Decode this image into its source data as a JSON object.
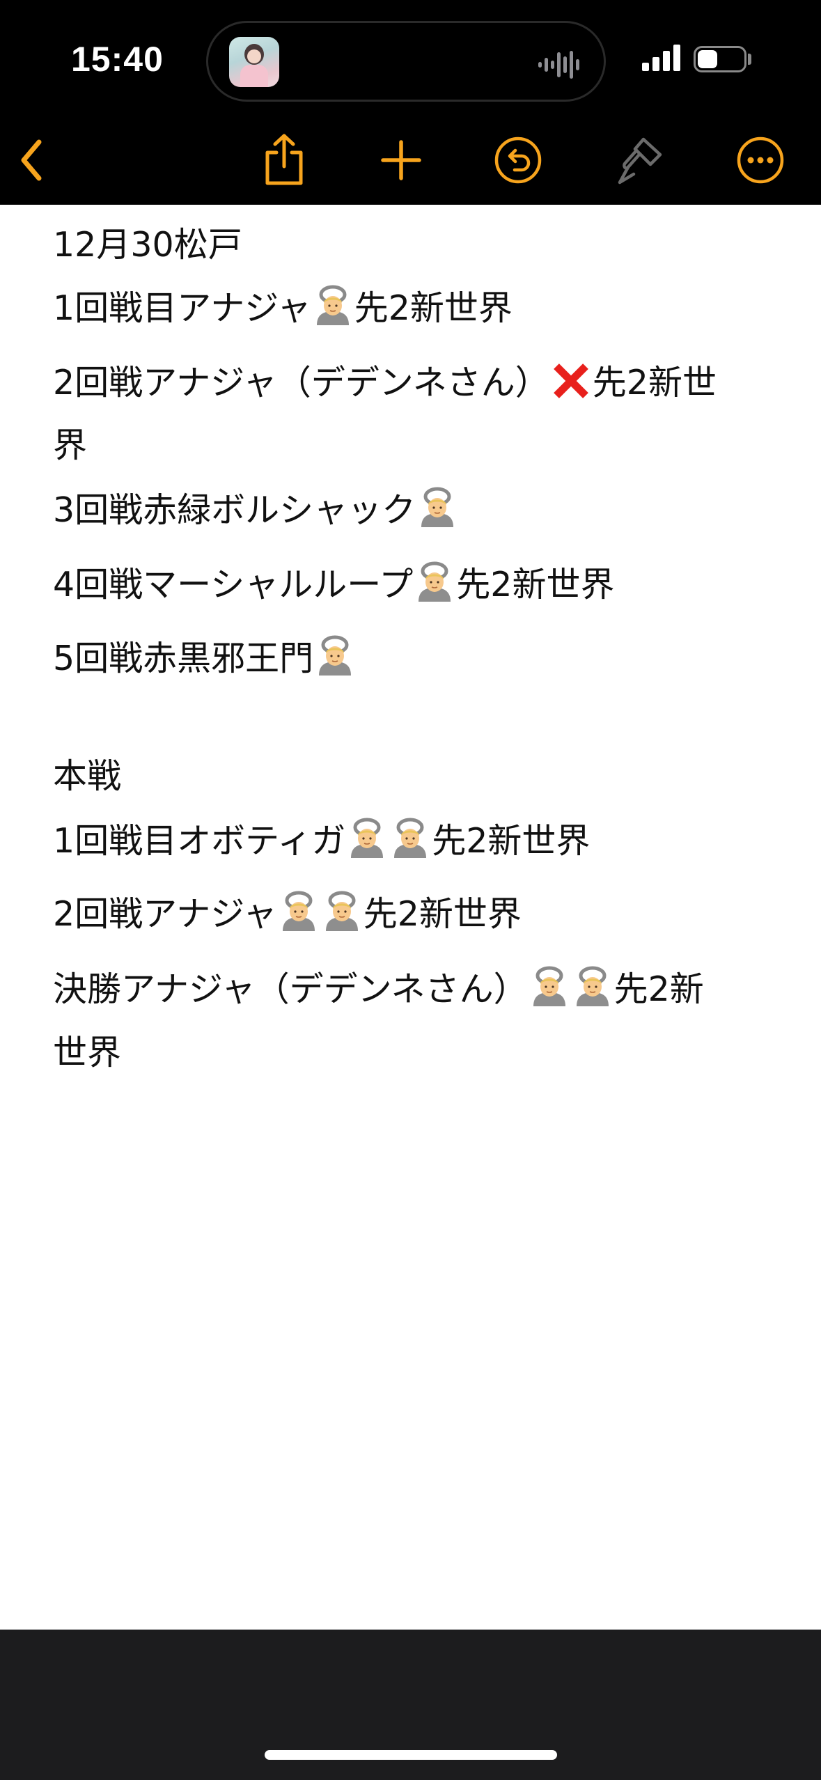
{
  "status_bar": {
    "time": "15:40",
    "icons": [
      "cellular-signal-icon",
      "battery-icon",
      "waveform-icon"
    ]
  },
  "toolbar": {
    "accent_color": "#f7a41d",
    "disabled_color": "#6b6b6b",
    "buttons": [
      "back",
      "share",
      "add",
      "undo",
      "format-brush",
      "more"
    ]
  },
  "note": {
    "lines": [
      {
        "segments": [
          {
            "text": "12月30松戸"
          }
        ]
      },
      {
        "segments": [
          {
            "text": "1回戦目アナジャ"
          },
          {
            "emoji": "ok-gesture-person"
          },
          {
            "text": "先2新世界"
          }
        ]
      },
      {
        "segments": [
          {
            "text": "2回戦アナジャ（デデンネさん）"
          },
          {
            "emoji": "red-cross-mark"
          },
          {
            "text": "先2新世"
          }
        ]
      },
      {
        "segments": [
          {
            "text": "界"
          }
        ]
      },
      {
        "segments": [
          {
            "text": "3回戦赤緑ボルシャック"
          },
          {
            "emoji": "ok-gesture-person"
          }
        ]
      },
      {
        "segments": [
          {
            "text": "4回戦マーシャルループ"
          },
          {
            "emoji": "ok-gesture-person"
          },
          {
            "text": "先2新世界"
          }
        ]
      },
      {
        "segments": [
          {
            "text": "5回戦赤黒邪王門"
          },
          {
            "emoji": "ok-gesture-person"
          }
        ]
      },
      {
        "segments": [
          {
            "text": "本戦"
          }
        ]
      },
      {
        "segments": [
          {
            "text": "1回戦目オボティガ"
          },
          {
            "emoji": "ok-gesture-person"
          },
          {
            "emoji": "ok-gesture-person"
          },
          {
            "text": "先2新世界"
          }
        ]
      },
      {
        "segments": [
          {
            "text": "2回戦アナジャ"
          },
          {
            "emoji": "ok-gesture-person"
          },
          {
            "emoji": "ok-gesture-person"
          },
          {
            "text": "先2新世界"
          }
        ]
      },
      {
        "segments": [
          {
            "text": "決勝アナジャ（デデンネさん）"
          },
          {
            "emoji": "ok-gesture-person"
          },
          {
            "emoji": "ok-gesture-person"
          },
          {
            "text": "先2新"
          }
        ]
      },
      {
        "segments": [
          {
            "text": "世界"
          }
        ]
      }
    ]
  }
}
